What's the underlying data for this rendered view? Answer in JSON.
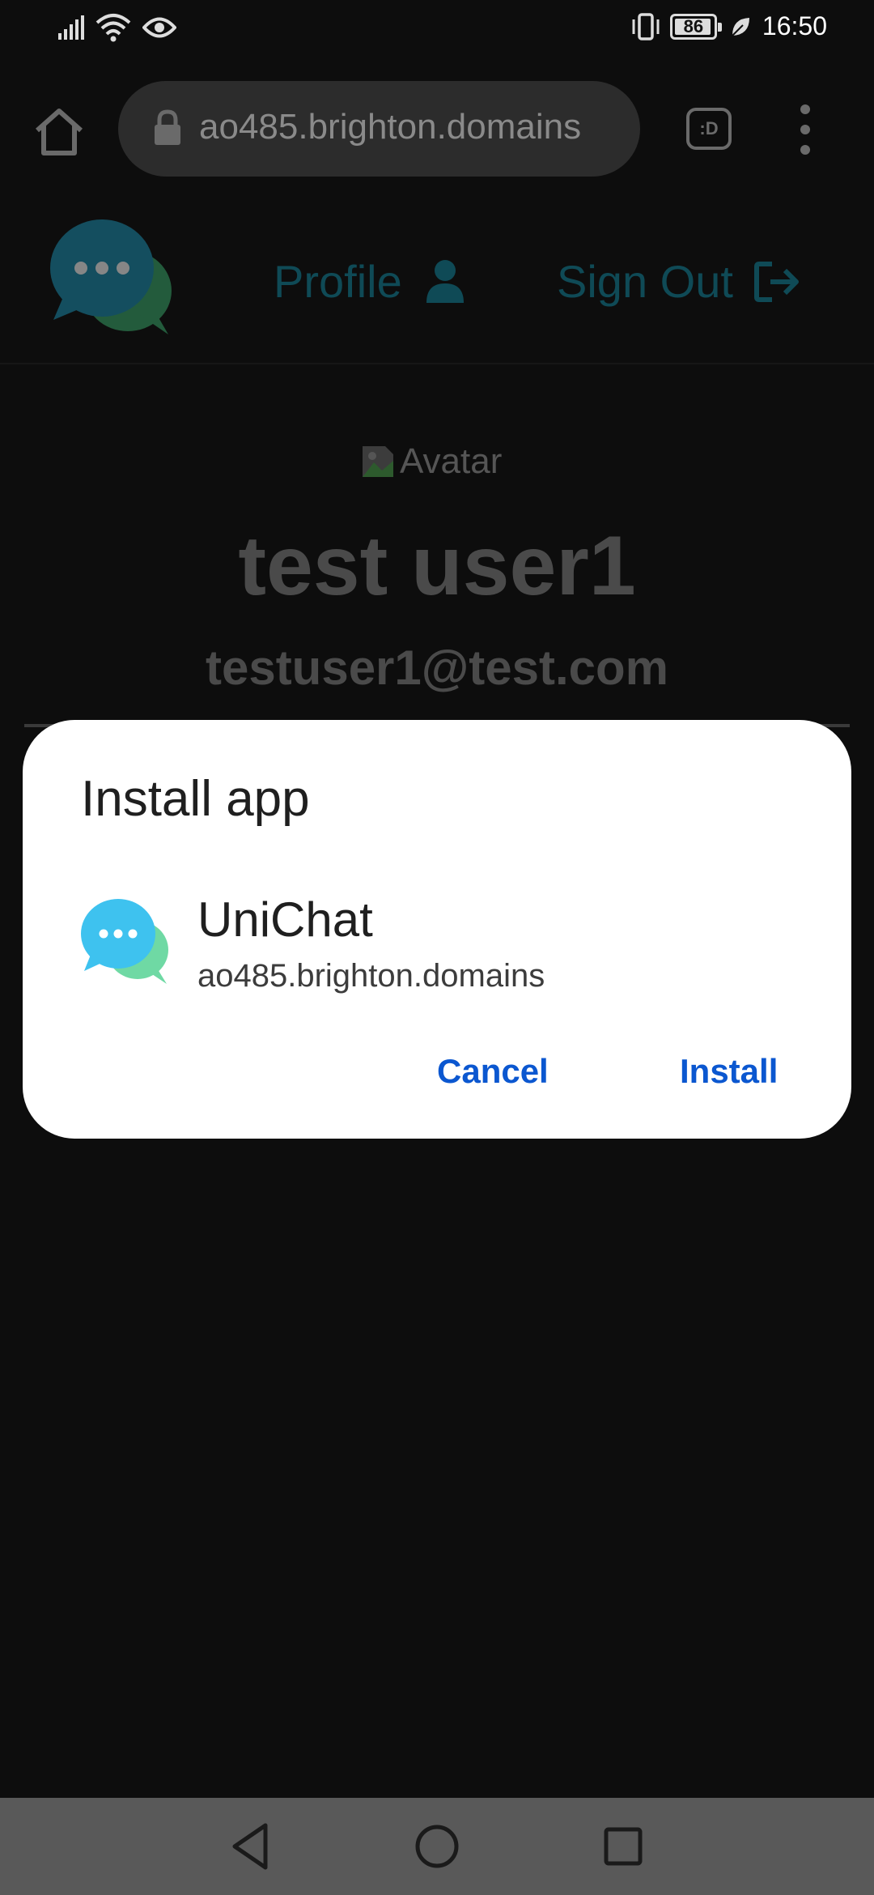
{
  "status_bar": {
    "time": "16:50",
    "battery_percent": "86",
    "icons": [
      "signal-icon",
      "wifi-icon",
      "eye-icon",
      "vibrate-icon",
      "battery-icon",
      "leaf-icon"
    ]
  },
  "browser": {
    "url": "ao485.brighton.domains",
    "tab_switcher_label": ":D"
  },
  "site_header": {
    "profile_label": "Profile",
    "signout_label": "Sign Out"
  },
  "profile": {
    "avatar_alt": "Avatar",
    "name": "test user1",
    "email": "testuser1@test.com"
  },
  "dialog": {
    "title": "Install app",
    "app_name": "UniChat",
    "app_url": "ao485.brighton.domains",
    "cancel_label": "Cancel",
    "install_label": "Install"
  },
  "colors": {
    "accent_blue": "#0b57d0",
    "nav_teal_dim": "#0f4a56",
    "background": "#0d0d0d"
  }
}
